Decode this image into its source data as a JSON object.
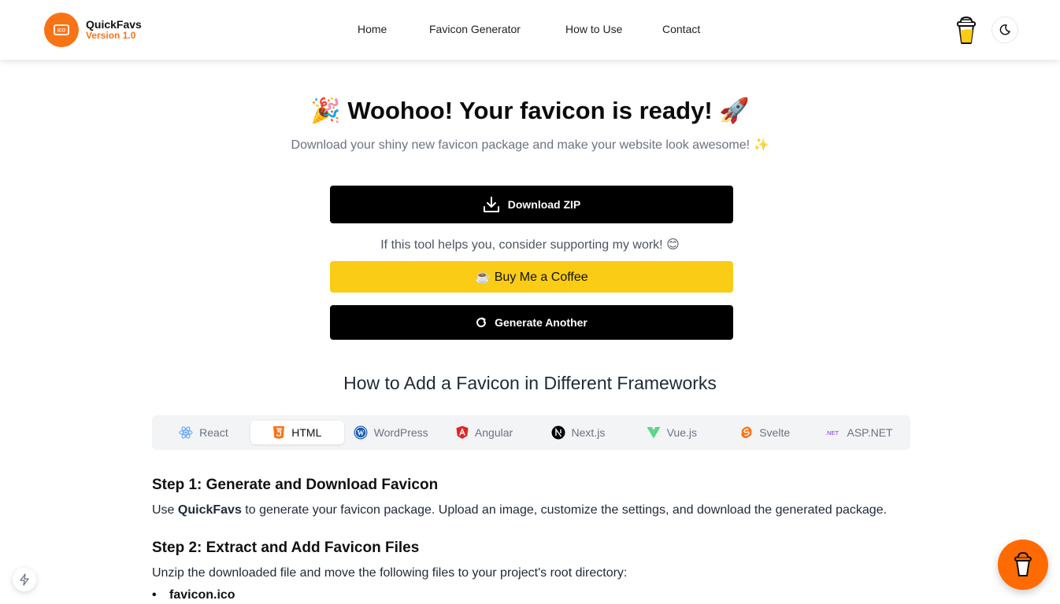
{
  "header": {
    "logo": {
      "icon": "ico-badge-icon",
      "title": "QuickFavs",
      "version": "Version 1.0"
    },
    "nav": [
      {
        "label": "Home"
      },
      {
        "label": "Favicon Generator"
      },
      {
        "label": "How to Use"
      },
      {
        "label": "Contact"
      }
    ],
    "buy_coffee_icon": "coffee-cup-icon",
    "theme_toggle_icon": "moon-icon"
  },
  "hero": {
    "title_prefix_emoji": "🎉",
    "title": "Woohoo! Your favicon is ready!",
    "title_suffix_emoji": "🚀",
    "subtitle": "Download your shiny new favicon package and make your website look awesome! ✨"
  },
  "actions": {
    "download_label": "Download ZIP",
    "support_text": "If this tool helps you, consider supporting my work! 😊",
    "coffee_label": "☕ Buy Me a Coffee",
    "generate_label": "Generate Another"
  },
  "frameworks": {
    "title": "How to Add a Favicon in Different Frameworks",
    "tabs": [
      {
        "label": "React",
        "icon": "react-icon",
        "active": false
      },
      {
        "label": "HTML",
        "icon": "html5-icon",
        "active": true
      },
      {
        "label": "WordPress",
        "icon": "wordpress-icon",
        "active": false
      },
      {
        "label": "Angular",
        "icon": "angular-icon",
        "active": false
      },
      {
        "label": "Next.js",
        "icon": "nextjs-icon",
        "active": false
      },
      {
        "label": "Vue.js",
        "icon": "vuejs-icon",
        "active": false
      },
      {
        "label": "Svelte",
        "icon": "svelte-icon",
        "active": false
      },
      {
        "label": "ASP.NET",
        "icon": "dotnet-icon",
        "active": false
      }
    ]
  },
  "steps": [
    {
      "title": "Step 1: Generate and Download Favicon",
      "text_prefix": "Use ",
      "text_bold": "QuickFavs",
      "text_suffix": " to generate your favicon package. Upload an image, customize the settings, and download the generated package."
    },
    {
      "title": "Step 2: Extract and Add Favicon Files",
      "text": "Unzip the downloaded file and move the following files to your project's root directory:",
      "files": [
        "favicon.ico"
      ]
    }
  ],
  "colors": {
    "brand": "#f97316",
    "coffee_button": "#facc15",
    "primary_button": "#000000",
    "fab": "#ff6b00"
  }
}
